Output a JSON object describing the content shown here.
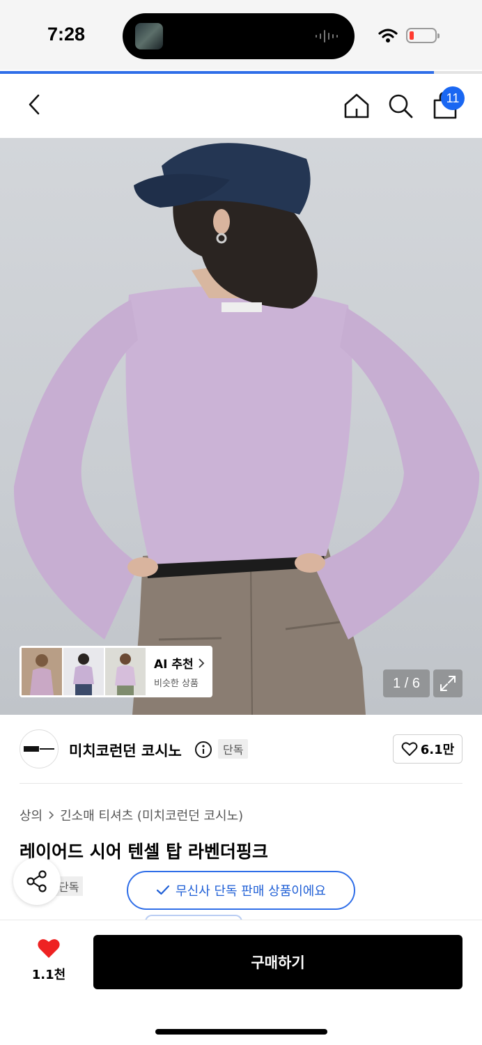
{
  "status_bar": {
    "time": "7:28",
    "battery_level": 0.1,
    "battery_color": "#ff3b30"
  },
  "page_progress": 0.9,
  "nav": {
    "cart_count": "11",
    "accent": "#1a67f2"
  },
  "gallery": {
    "page_counter": "1 / 6",
    "ai_card": {
      "title": "AI 추천",
      "subtitle": "비슷한 상품"
    }
  },
  "brand": {
    "name": "미치코런던 코시노",
    "tag": "단독",
    "likes": "6.1만"
  },
  "product": {
    "breadcrumb": [
      "상의",
      "긴소매 티셔츠 (미치코런던 코시노)"
    ],
    "title": "레이어드 시어 텐셀 탑 라벤더핑크",
    "tag": "단독",
    "exclusive_notice": "무신사 단독 판매 상품이에요"
  },
  "bottom_bar": {
    "wish_count": "1.1천",
    "buy_label": "구매하기",
    "heart_color": "#ee2222"
  }
}
